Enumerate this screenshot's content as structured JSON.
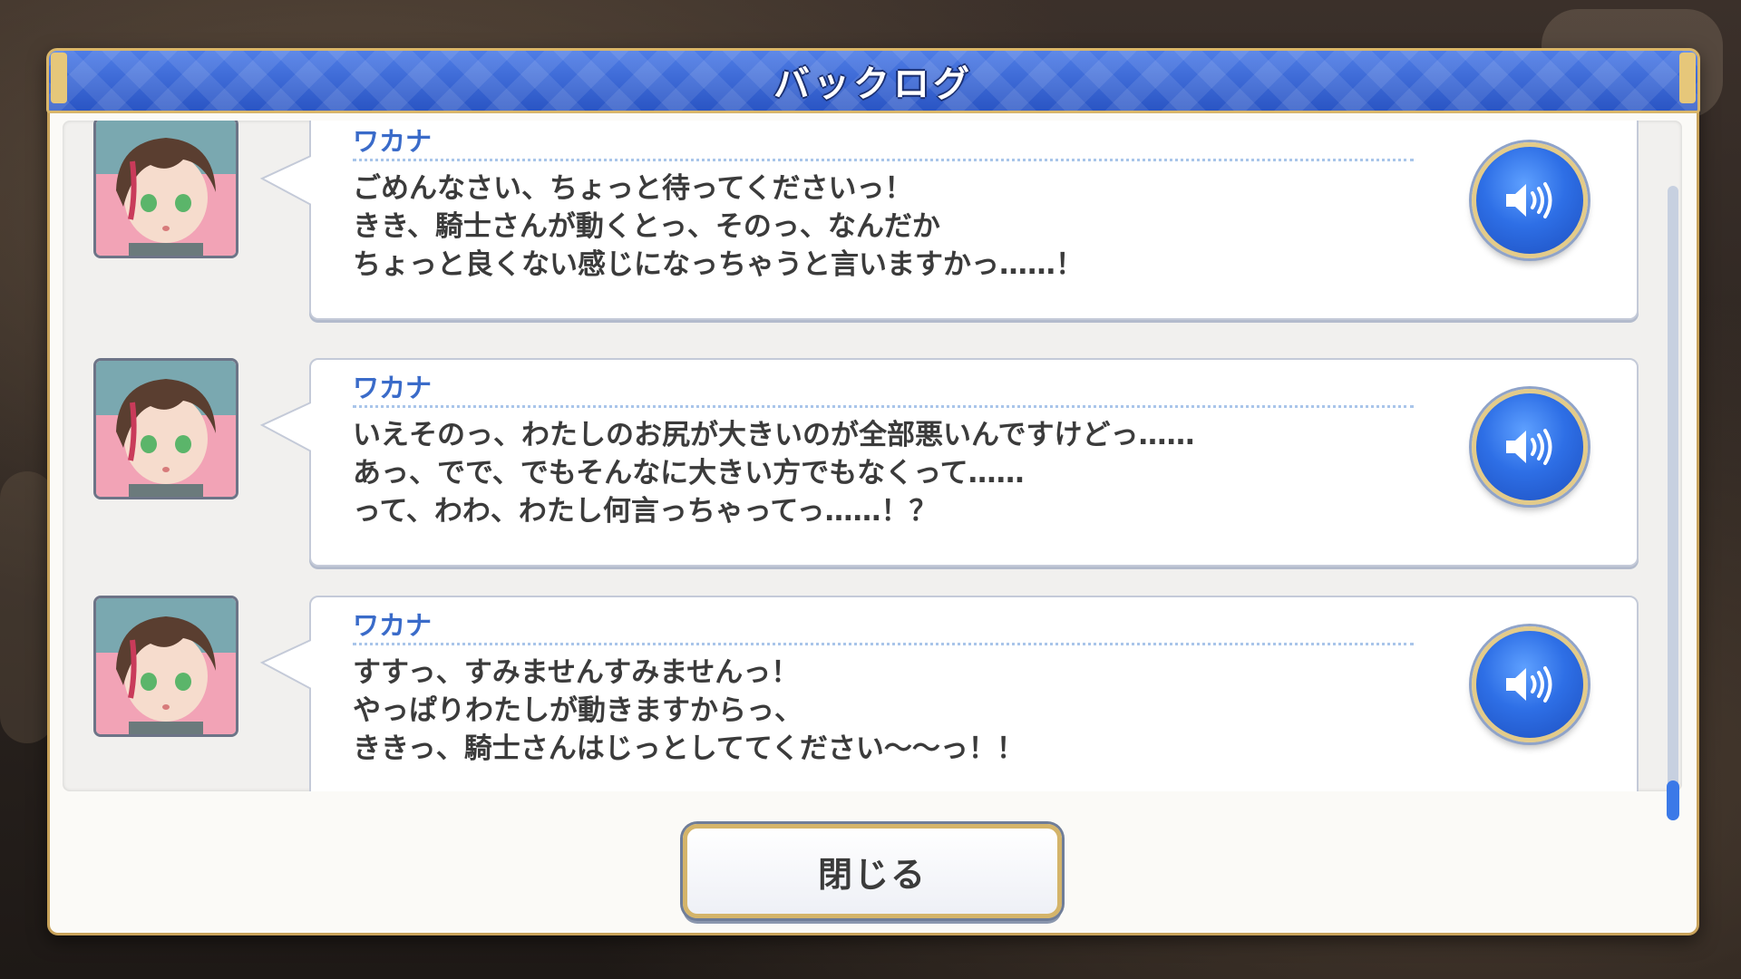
{
  "window": {
    "title": "バックログ"
  },
  "entries": [
    {
      "speaker": "ワカナ",
      "lines": [
        "ごめんなさい、ちょっと待ってくださいっ！",
        "きき、騎士さんが動くとっ、そのっ、なんだか",
        "ちょっと良くない感じになっちゃうと言いますかっ……！"
      ],
      "voice_icon": "speaker-volume-icon"
    },
    {
      "speaker": "ワカナ",
      "lines": [
        "いえそのっ、わたしのお尻が大きいのが全部悪いんですけどっ……",
        "あっ、でで、でもそんなに大きい方でもなくって……",
        "って、わわ、わたし何言っちゃってっ……！？"
      ],
      "voice_icon": "speaker-volume-icon"
    },
    {
      "speaker": "ワカナ",
      "lines": [
        "すすっ、すみませんすみませんっ！",
        "やっぱりわたしが動きますからっ、",
        "ききっ、騎士さんはじっとしててください～～っ！！"
      ],
      "voice_icon": "speaker-volume-icon"
    }
  ],
  "footer": {
    "close_label": "閉じる"
  },
  "colors": {
    "accent": "#2f59c8",
    "gold": "#d4b46a",
    "speaker": "#3a6bc9"
  }
}
